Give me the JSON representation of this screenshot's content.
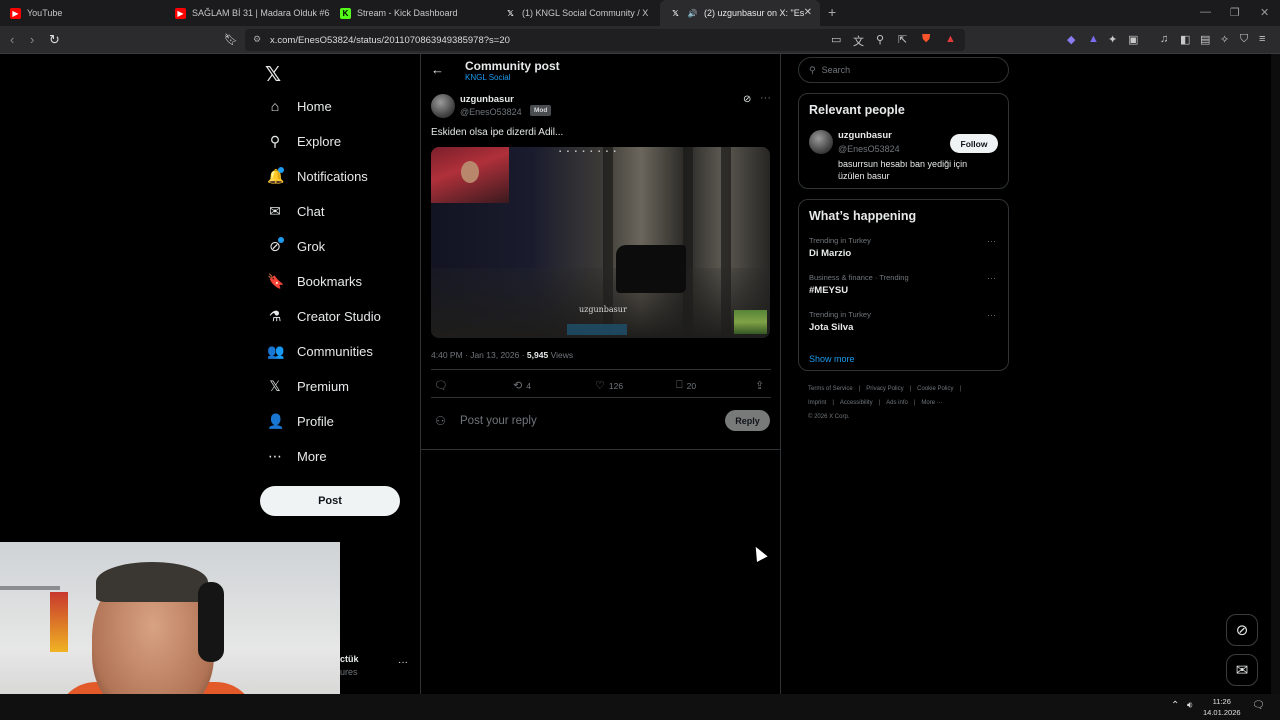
{
  "browser": {
    "tabs": [
      {
        "title": "YouTube",
        "favicon_color": "#ff0000",
        "favicon_glyph": "▶"
      },
      {
        "title": "SAĞLAM Bİ 31 | Madara Olduk #634",
        "favicon_color": "#ff0000",
        "favicon_glyph": "▶"
      },
      {
        "title": "Stream - Kick Dashboard",
        "favicon_color": "#53fc18",
        "favicon_glyph": "K"
      },
      {
        "title": "(1) KNGL Social Community / X",
        "favicon_color": "#2b2b2e",
        "favicon_glyph": "𝕏"
      },
      {
        "title": "(2) uzgunbasur on X: \"Eskiden",
        "favicon_color": "#2b2b2e",
        "favicon_glyph": "𝕏"
      }
    ],
    "url": "x.com/EnesO53824/status/2011070863949385978?s=20"
  },
  "x": {
    "nav": [
      {
        "label": "Home",
        "icon": "home-icon",
        "glyph": "⌂"
      },
      {
        "label": "Explore",
        "icon": "search-icon",
        "glyph": "⚲"
      },
      {
        "label": "Notifications",
        "icon": "bell-icon",
        "glyph": "🔔"
      },
      {
        "label": "Chat",
        "icon": "mail-icon",
        "glyph": "✉"
      },
      {
        "label": "Grok",
        "icon": "grok-icon",
        "glyph": "⊘"
      },
      {
        "label": "Bookmarks",
        "icon": "bookmark-icon",
        "glyph": "🔖"
      },
      {
        "label": "Creator Studio",
        "icon": "flask-icon",
        "glyph": "⚗"
      },
      {
        "label": "Communities",
        "icon": "people-icon",
        "glyph": "👥"
      },
      {
        "label": "Premium",
        "icon": "x-logo-icon",
        "glyph": "𝕏"
      },
      {
        "label": "Profile",
        "icon": "person-icon",
        "glyph": "👤"
      },
      {
        "label": "More",
        "icon": "more-circle-icon",
        "glyph": "⋯"
      }
    ],
    "post_button": "Post",
    "account": {
      "name": "ctük",
      "handle": "ures"
    },
    "header": {
      "title": "Community post",
      "subtitle": "KNGL Social"
    },
    "post": {
      "author": "uzgunbasur",
      "handle": "@EnesO53824",
      "badge": "Mod",
      "text": "Eskiden olsa ipe dizerdi Adil...",
      "media_caption": "uzgunbasur",
      "time": "4:40 PM · Jan 13, 2026 · ",
      "views_count": "5,945",
      "views_label": " Views",
      "reposts": "4",
      "likes": "126",
      "bookmarks": "20"
    },
    "reply": {
      "placeholder": "Post your reply",
      "button": "Reply"
    },
    "search_placeholder": "Search",
    "relevant": {
      "title": "Relevant people",
      "name": "uzgunbasur",
      "handle": "@EnesO53824",
      "bio": "basurrsun hesabı ban yediği için üzülen basur",
      "follow": "Follow"
    },
    "happening": {
      "title": "What’s happening",
      "trends": [
        {
          "category": "Trending in Turkey",
          "name": "Di Marzio"
        },
        {
          "category": "Business & finance · Trending",
          "name": "#MEYSU"
        },
        {
          "category": "Trending in Turkey",
          "name": "Jota Silva"
        }
      ],
      "show_more": "Show more"
    },
    "footer": [
      "Terms of Service",
      "|",
      "Privacy Policy",
      "|",
      "Cookie Policy",
      "|",
      "Imprint",
      "|",
      "Accessibility",
      "|",
      "Ads info",
      "|",
      "More ···",
      "© 2026 X Corp."
    ]
  },
  "taskbar": {
    "time": "11:26",
    "date": "14.01.2026"
  }
}
